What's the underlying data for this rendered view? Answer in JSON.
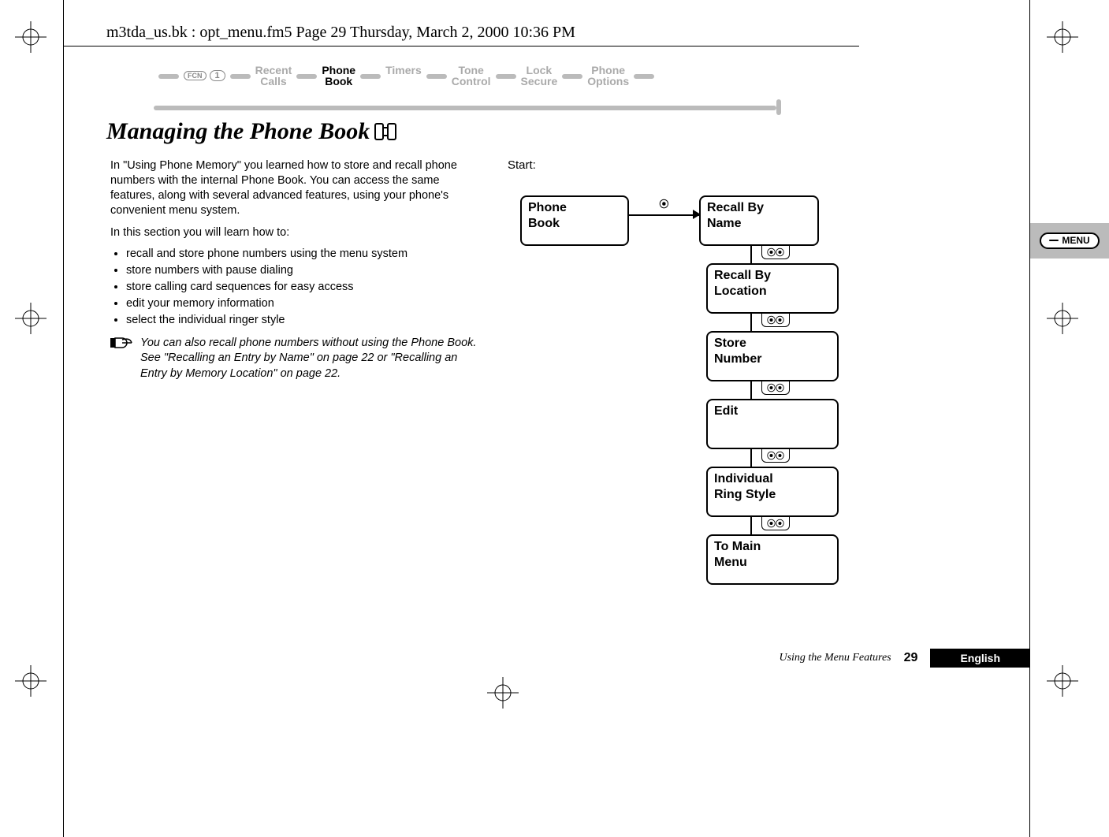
{
  "running_header": "m3tda_us.bk : opt_menu.fm5  Page 29  Thursday, March 2, 2000  10:36 PM",
  "nav": {
    "fcn_label": "FCN",
    "one_label": "1",
    "items": [
      {
        "label_top": "Recent",
        "label_bot": "Calls",
        "active": false
      },
      {
        "label_top": "Phone",
        "label_bot": "Book",
        "active": true
      },
      {
        "label_top": "Timers",
        "label_bot": "",
        "active": false
      },
      {
        "label_top": "Tone",
        "label_bot": "Control",
        "active": false
      },
      {
        "label_top": "Lock",
        "label_bot": "Secure",
        "active": false
      },
      {
        "label_top": "Phone",
        "label_bot": "Options",
        "active": false
      }
    ]
  },
  "title": "Managing the Phone Book",
  "intro_paragraph": "In \"Using Phone Memory\"  you learned how to store and recall phone numbers with the internal Phone Book. You can access the same features, along with several advanced features, using your phone's convenient menu system.",
  "list_intro": "In this section you will learn how to:",
  "bullets": [
    "recall and store phone numbers using the menu system",
    "store numbers with pause dialing",
    "store calling card sequences for easy access",
    "edit your memory information",
    "select the individual ringer style"
  ],
  "note_icon": "☞",
  "note_prefix": "You can also recall phone numbers without using the Phone Book. See \"Recalling an Entry by Name\" on page 22 or \"Recalling an Entry by Memory Location\" on page 22.",
  "start_label": "Start:",
  "flow": {
    "root_top": "Phone",
    "root_bot": "Book",
    "arrow_badge": "⦿",
    "vconn_badge": "⦿⦿",
    "items": [
      {
        "l1": "Recall By",
        "l2": "Name"
      },
      {
        "l1": "Recall By",
        "l2": "Location"
      },
      {
        "l1": "Store",
        "l2": "Number"
      },
      {
        "l1": "Edit",
        "l2": ""
      },
      {
        "l1": "Individual",
        "l2": "Ring Style"
      },
      {
        "l1": "To Main",
        "l2": "Menu"
      }
    ]
  },
  "side_tab_label": "MENU",
  "footer": {
    "using": "Using the Menu Features",
    "page_number": "29",
    "language": "English"
  }
}
